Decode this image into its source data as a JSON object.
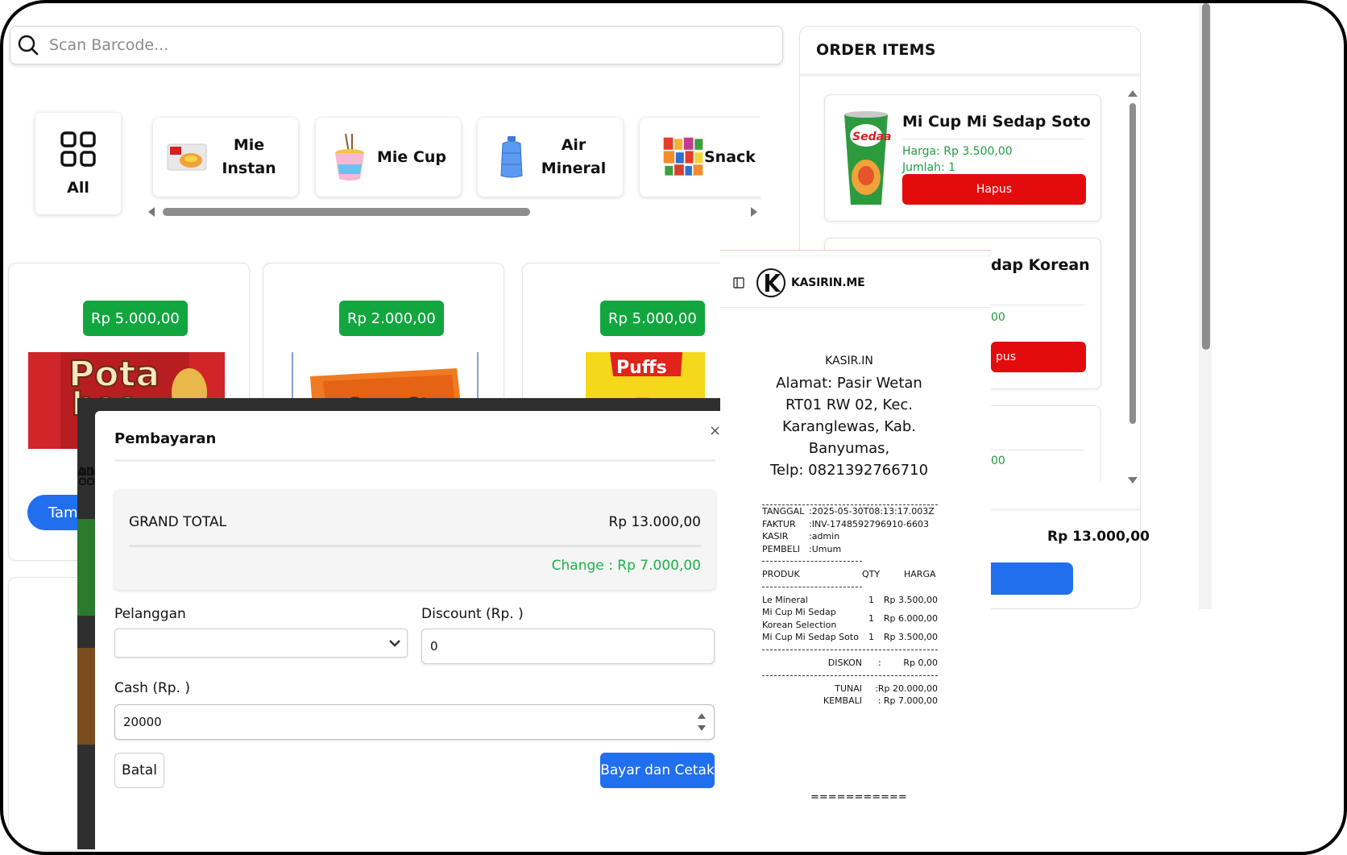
{
  "search": {
    "placeholder": "Scan Barcode..."
  },
  "categories": {
    "all_label": "All",
    "items": [
      {
        "label_l1": "Mie",
        "label_l2": "Instan"
      },
      {
        "label_l1": "Mie Cup",
        "label_l2": ""
      },
      {
        "label_l1": "Air",
        "label_l2": "Mineral"
      },
      {
        "label_l1": "Snack",
        "label_l2": ""
      }
    ]
  },
  "products": [
    {
      "price": "Rp 5.000,00"
    },
    {
      "price": "Rp 2.000,00"
    },
    {
      "price": "Rp 5.000,00"
    }
  ],
  "product_button_label": "Tamb",
  "order": {
    "title": "ORDER ITEMS",
    "items": [
      {
        "name": "Mi Cup Mi Sedap Soto",
        "harga": "Harga: Rp 3.500,00",
        "jumlah": "Jumlah: 1",
        "hapus": "Hapus"
      },
      {
        "name": "dap Korean",
        "harga": "00",
        "hapus": "pus"
      },
      {
        "harga": "00"
      }
    ],
    "total": "Rp 13.000,00"
  },
  "modal": {
    "title": "Pembayaran",
    "close": "×",
    "grand_total_label": "GRAND TOTAL",
    "grand_total_value": "Rp 13.000,00",
    "change": "Change : Rp 7.000,00",
    "pelanggan_label": "Pelanggan",
    "pelanggan_value": "",
    "discount_label": "Discount (Rp. )",
    "discount_value": "0",
    "cash_label": "Cash (Rp. )",
    "cash_value": "20000",
    "batal": "Batal",
    "bayar": "Bayar dan Cetak",
    "ghost_all": "All"
  },
  "receipt": {
    "brand": "KASIRIN.ME",
    "store": "KASIR.IN",
    "address_lines": [
      "Alamat: Pasir Wetan",
      "RT01 RW 02, Kec.",
      "Karanglewas, Kab.",
      "Banyumas,",
      "Telp: 0821392766710"
    ],
    "meta": [
      {
        "k": "TANGGAL",
        "v": ":2025-05-30T08:13:17.003Z"
      },
      {
        "k": "FAKTUR",
        "v": ":INV-1748592796910-6603"
      },
      {
        "k": "KASIR",
        "v": ":admin"
      },
      {
        "k": "PEMBELI",
        "v": ":Umum"
      }
    ],
    "col_produk": "PRODUK",
    "col_qty": "QTY",
    "col_harga": "HARGA",
    "lines": [
      {
        "name": "Le Mineral",
        "name2": "",
        "qty": "1",
        "price": "Rp 3.500,00"
      },
      {
        "name": "Mi Cup Mi Sedap",
        "name2": "Korean Selection",
        "qty": "1",
        "price": "Rp 6.000,00"
      },
      {
        "name": "Mi Cup Mi Sedap Soto",
        "name2": "",
        "qty": "1",
        "price": "Rp 3.500,00"
      }
    ],
    "diskon_label": "DISKON",
    "diskon_sep": ":",
    "diskon_value": "Rp 0,00",
    "tunai_label": "TUNAI",
    "tunai_value": ":Rp 20.000,00",
    "kembali_label": "KEMBALI",
    "kembali_value": ":  Rp 7.000,00",
    "footer": "==========="
  },
  "colors": {
    "accent": "#1f6fee",
    "price_badge": "#12a63f",
    "danger": "#e30b0b",
    "change": "#1eb04c"
  }
}
